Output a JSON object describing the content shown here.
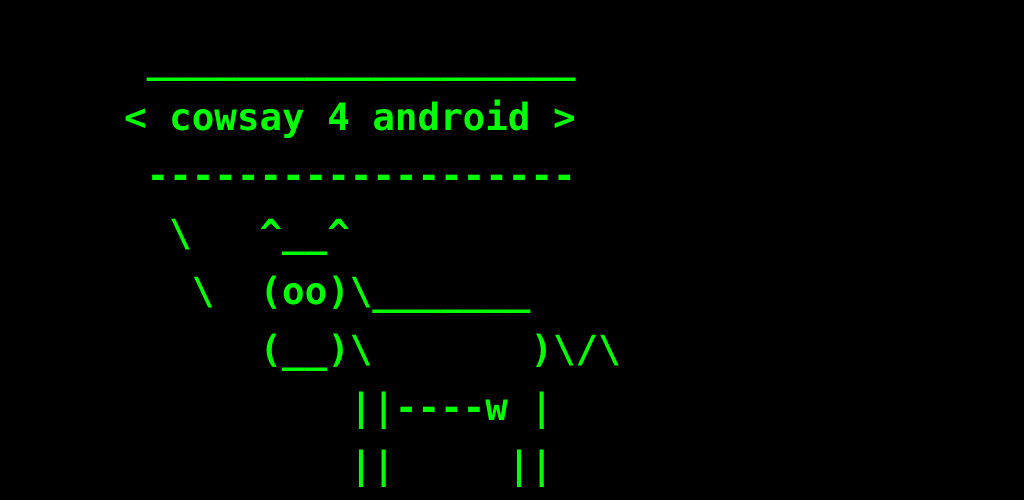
{
  "theme": {
    "background": "#000000",
    "foreground": "#00ff00"
  },
  "art": {
    "lines": [
      " ___________________",
      "< cowsay 4 android >",
      " -------------------",
      "  \\   ^__^",
      "   \\  (oo)\\_______",
      "      (__)\\       )\\/\\",
      "          ||----w |",
      "          ||     ||"
    ]
  }
}
